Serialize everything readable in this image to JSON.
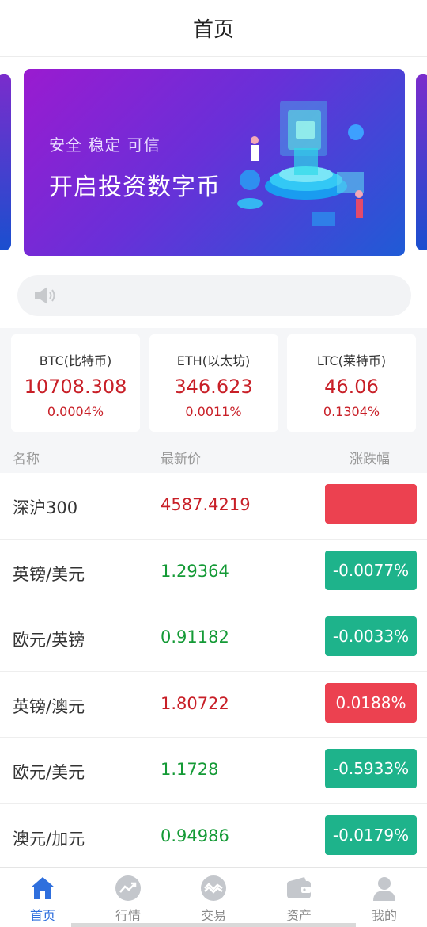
{
  "header": {
    "title": "首页"
  },
  "banner": {
    "subtitle": "安全 稳定 可信",
    "title": "开启投资数字币"
  },
  "notice": {
    "icon": "speaker-icon",
    "text": ""
  },
  "tickers": [
    {
      "name": "BTC(比特币)",
      "price": "10708.308",
      "change": "0.0004%"
    },
    {
      "name": "ETH(以太坊)",
      "price": "346.623",
      "change": "0.0011%"
    },
    {
      "name": "LTC(莱特币)",
      "price": "46.06",
      "change": "0.1304%"
    }
  ],
  "columns": {
    "name": "名称",
    "price": "最新价",
    "change": "涨跌幅"
  },
  "markets": [
    {
      "name": "深沪300",
      "price": "4587.4219",
      "change": "",
      "trend": "up"
    },
    {
      "name": "英镑/美元",
      "price": "1.29364",
      "change": "-0.0077%",
      "trend": "down"
    },
    {
      "name": "欧元/英镑",
      "price": "0.91182",
      "change": "-0.0033%",
      "trend": "down"
    },
    {
      "name": "英镑/澳元",
      "price": "1.80722",
      "change": "0.0188%",
      "trend": "up"
    },
    {
      "name": "欧元/美元",
      "price": "1.1728",
      "change": "-0.5933%",
      "trend": "down"
    },
    {
      "name": "澳元/加元",
      "price": "0.94986",
      "change": "-0.0179%",
      "trend": "down"
    }
  ],
  "tabbar": [
    {
      "label": "首页",
      "icon": "home-icon",
      "active": true
    },
    {
      "label": "行情",
      "icon": "trend-icon",
      "active": false
    },
    {
      "label": "交易",
      "icon": "exchange-icon",
      "active": false
    },
    {
      "label": "资产",
      "icon": "wallet-icon",
      "active": false
    },
    {
      "label": "我的",
      "icon": "user-icon",
      "active": false
    }
  ],
  "colors": {
    "up": "#c81f27",
    "down": "#149a36",
    "up_badge": "#ec4150",
    "down_badge": "#1eb38b",
    "accent": "#2f6fdd"
  }
}
